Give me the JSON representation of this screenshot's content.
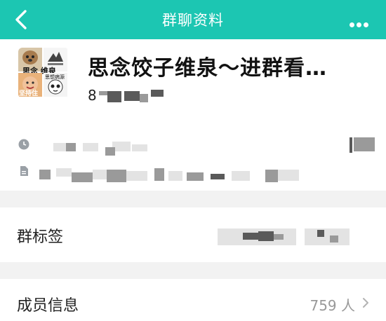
{
  "header": {
    "title": "群聊资料",
    "back_icon": "chevron-left-icon",
    "more_icon": "more-dots-icon",
    "color": "#1cc6b2"
  },
  "group": {
    "name": "思念饺子维泉～进群看…",
    "avatar_caption_1": "思念 维泉",
    "avatar_caption_2": "坚持住",
    "avatar_caption_3": "思想病源",
    "id_prefix": "8"
  },
  "tags": {
    "label": "群标签"
  },
  "members": {
    "label": "成员信息",
    "count": "759 人"
  }
}
